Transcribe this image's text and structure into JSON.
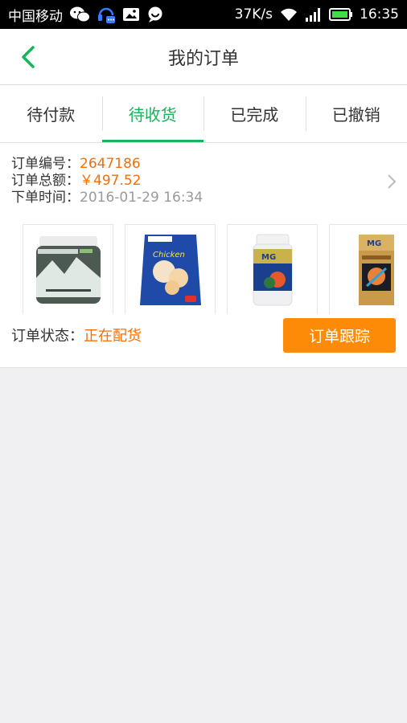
{
  "status_bar": {
    "carrier": "中国移动",
    "network_speed": "37K/s",
    "time": "16:35",
    "icons": [
      "wechat-icon",
      "headset-app-icon",
      "image-icon",
      "chat-bubble-icon",
      "wifi-icon",
      "signal-icon",
      "battery-icon"
    ]
  },
  "header": {
    "title": "我的订单",
    "back_icon": "chevron-left-icon"
  },
  "tabs": [
    {
      "label": "待付款",
      "active": false
    },
    {
      "label": "待收货",
      "active": true
    },
    {
      "label": "已完成",
      "active": false
    },
    {
      "label": "已撤销",
      "active": false
    }
  ],
  "order": {
    "number_label": "订单编号：",
    "number": "2647186",
    "total_label": "订单总额：",
    "total": "￥497.52",
    "time_label": "下单时间：",
    "time": "2016-01-29 16:34",
    "products": [
      {
        "name": "Nutrition powder jar",
        "icon": "product-jar-icon"
      },
      {
        "name": "Pet treats bag",
        "icon": "product-bag-icon"
      },
      {
        "name": "Super Calcium bottle",
        "icon": "product-bottle-icon"
      },
      {
        "name": "Joint health gold edition box",
        "icon": "product-box-icon"
      }
    ],
    "status_label": "订单状态：",
    "status": "正在配货",
    "track_button": "订单跟踪"
  },
  "colors": {
    "accent_green": "#16b559",
    "orange_text": "#f36f0b",
    "button_orange": "#fe8b08",
    "page_bg": "#f0eff1"
  }
}
